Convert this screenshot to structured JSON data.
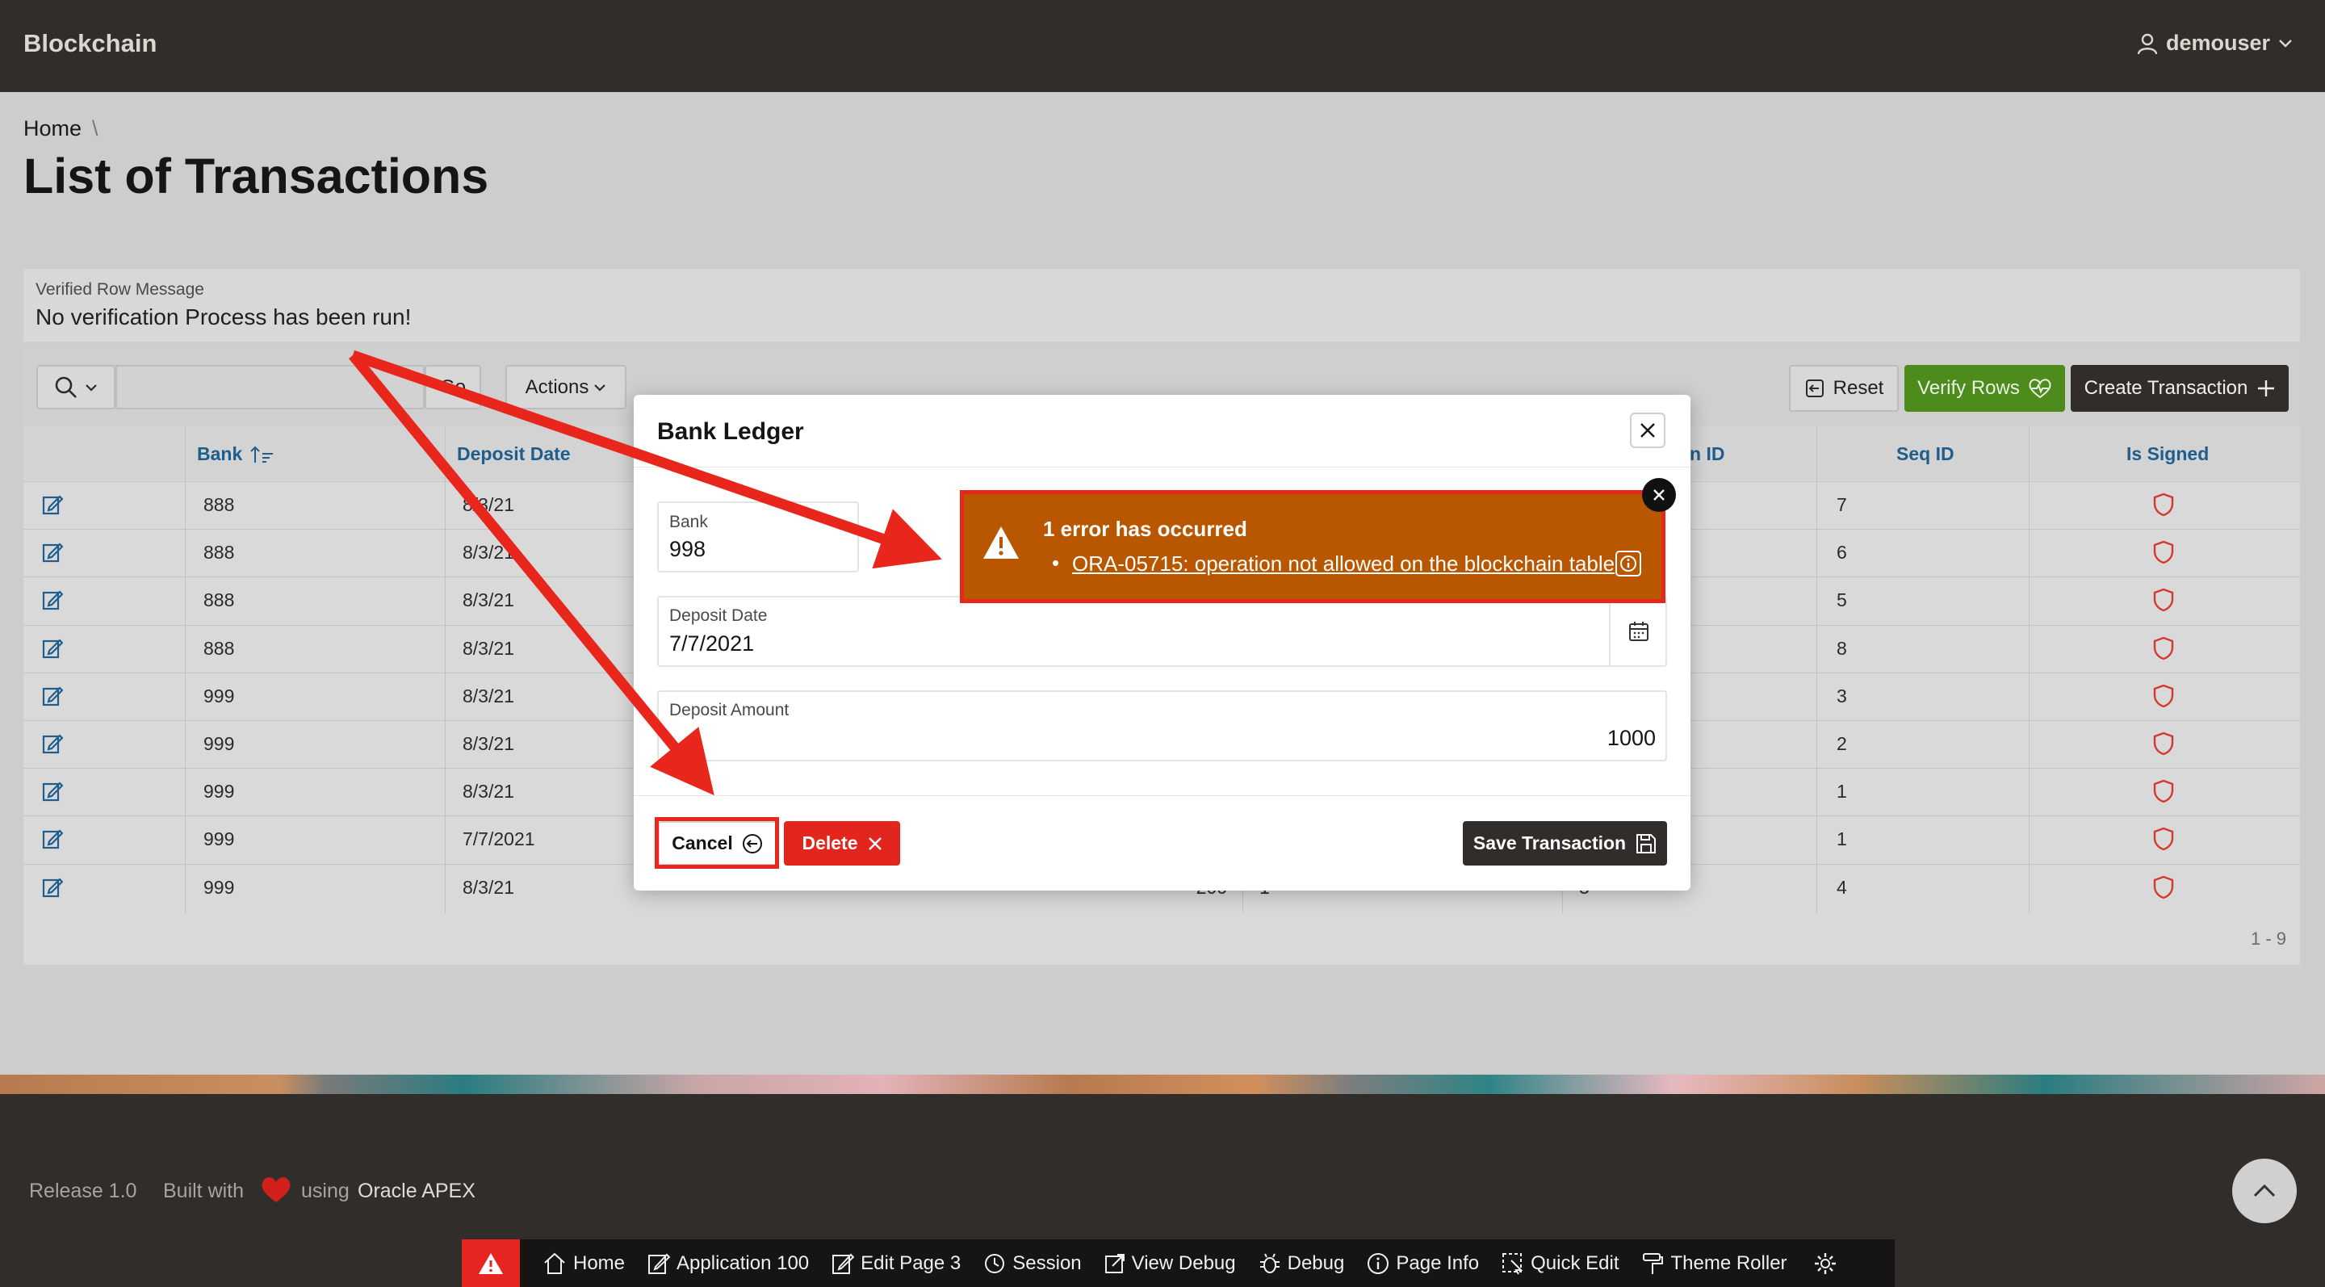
{
  "header": {
    "app_title": "Blockchain",
    "user": "demouser"
  },
  "breadcrumb": {
    "home": "Home",
    "separator": "\\"
  },
  "page_title": "List of Transactions",
  "verified_row": {
    "label": "Verified Row Message",
    "text": "No verification Process has been run!"
  },
  "toolbar": {
    "go_label": "Go",
    "actions_label": "Actions",
    "reset_label": "Reset",
    "verify_label": "Verify Rows",
    "create_label": "Create Transaction"
  },
  "columns": {
    "bank": "Bank",
    "deposit_date": "Deposit Date",
    "chain_id": "n ID",
    "seq_id": "Seq ID",
    "is_signed": "Is Signed"
  },
  "rows": [
    {
      "bank": "888",
      "date": "8/3/21",
      "seq": "7"
    },
    {
      "bank": "888",
      "date": "8/3/21",
      "seq": "6"
    },
    {
      "bank": "888",
      "date": "8/3/21",
      "seq": "5"
    },
    {
      "bank": "888",
      "date": "8/3/21",
      "seq": "8"
    },
    {
      "bank": "999",
      "date": "8/3/21",
      "seq": "3"
    },
    {
      "bank": "999",
      "date": "8/3/21",
      "seq": "2"
    },
    {
      "bank": "999",
      "date": "8/3/21",
      "seq": "1"
    },
    {
      "bank": "999",
      "date": "7/7/2021",
      "seq": "1"
    },
    {
      "bank": "999",
      "date": "8/3/21",
      "seq": "4",
      "amount": "-200",
      "col5": "1",
      "col6": "3"
    }
  ],
  "pagination": "1 - 9",
  "dialog": {
    "title": "Bank Ledger",
    "bank_label": "Bank",
    "bank_value": "998",
    "date_label": "Deposit Date",
    "date_value": "7/7/2021",
    "amount_label": "Deposit Amount",
    "amount_value": "1000",
    "cancel_label": "Cancel",
    "delete_label": "Delete",
    "save_label": "Save Transaction"
  },
  "error": {
    "title": "1 error has occurred",
    "bullet": "•",
    "message": "ORA-05715: operation not allowed on the blockchain table"
  },
  "footer": {
    "release": "Release 1.0",
    "built_with": "Built with",
    "using": "using",
    "oracle_apex": "Oracle APEX"
  },
  "dev_toolbar": {
    "items": [
      "Home",
      "Application 100",
      "Edit Page 3",
      "Session",
      "View Debug",
      "Debug",
      "Page Info",
      "Quick Edit",
      "Theme Roller"
    ]
  },
  "colors": {
    "header_bg": "#312d2a",
    "error_bg": "#b95700",
    "highlight": "#e8261c",
    "verify_bg": "#4c8b1c",
    "delete_bg": "#e3261d",
    "link": "#1e5d8c"
  }
}
